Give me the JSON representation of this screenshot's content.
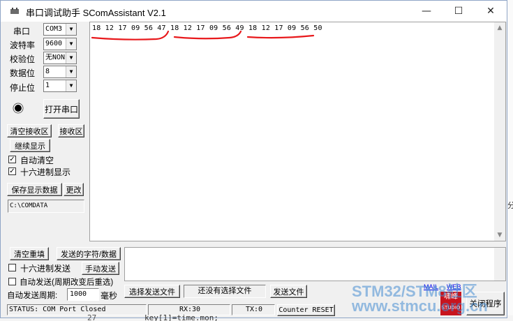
{
  "window": {
    "title": "串口调试助手 SComAssistant V2.1",
    "minimize_glyph": "—",
    "maximize_glyph": "☐",
    "close_glyph": "✕"
  },
  "serial_settings": {
    "port_label": "串口",
    "port_value": "COM3",
    "baud_label": "波特率",
    "baud_value": "9600",
    "parity_label": "校验位",
    "parity_value": "无NONE",
    "databits_label": "数据位",
    "databits_value": "8",
    "stopbits_label": "停止位",
    "stopbits_value": "1",
    "open_port_button": "打开串口"
  },
  "receive_panel": {
    "clear_button": "清空接收区",
    "receive_area_button": "接收区",
    "continue_display_button": "继续显示",
    "auto_clear_label": "自动清空",
    "auto_clear_checked": true,
    "hex_display_label": "十六进制显示",
    "hex_display_checked": true,
    "save_data_button": "保存显示数据",
    "change_button": "更改",
    "save_path": "C:\\COMDATA",
    "received_text": "18 12 17 09 56 47 18 12 17 09 56 49 18 12 17 09 56 50"
  },
  "send_panel": {
    "clear_resend_button": "清空重填",
    "sent_chars_button": "发送的字符/数据",
    "hex_send_label": "十六进制发送",
    "hex_send_checked": false,
    "manual_send_button": "手动发送",
    "auto_send_label": "自动发送(周期改变后重选)",
    "auto_send_checked": false,
    "period_label": "自动发送周期:",
    "period_value": "1000",
    "period_unit": "毫秒",
    "select_file_button": "选择发送文件",
    "no_file_text": "还没有选择文件",
    "send_file_button": "发送文件"
  },
  "status_bar": {
    "status": "STATUS: COM Port Closed",
    "rx": "RX:30",
    "tx": "TX:0",
    "counter_reset_button": "Counter RESET"
  },
  "branding": {
    "mail_link": "MAIL",
    "web_link": "WEB",
    "logo_text_top": "啸峰",
    "logo_text_bottom": "STUDIO",
    "close_program_button": "关闭程序"
  },
  "watermark": {
    "line1": "STM32/STM8社区",
    "line2": "www.stmcu.org.cn"
  },
  "background": {
    "line_number": "27",
    "code_snippet": "key[1]=time.mon;",
    "right_char": "分"
  },
  "annotation_color": "#e8191c"
}
